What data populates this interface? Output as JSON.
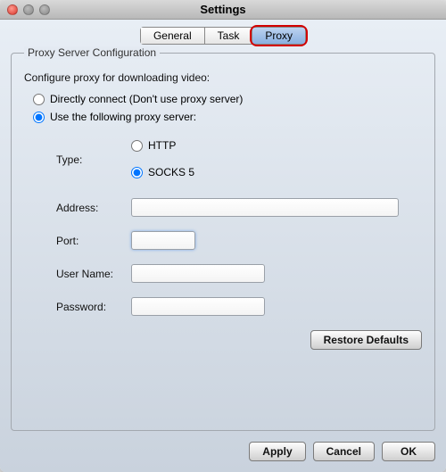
{
  "window": {
    "title": "Settings"
  },
  "tabs": {
    "general": "General",
    "task": "Task",
    "proxy": "Proxy"
  },
  "group": {
    "legend": "Proxy Server Configuration",
    "subtitle": "Configure proxy for downloading video:",
    "direct_label": "Directly connect (Don't use proxy server)",
    "useproxy_label": "Use the following proxy server:"
  },
  "form": {
    "type_label": "Type:",
    "http_label": "HTTP",
    "socks_label": "SOCKS 5",
    "address_label": "Address:",
    "address_value": "",
    "port_label": "Port:",
    "port_value": "",
    "user_label": "User Name:",
    "user_value": "",
    "pass_label": "Password:",
    "pass_value": ""
  },
  "buttons": {
    "restore": "Restore Defaults",
    "apply": "Apply",
    "cancel": "Cancel",
    "ok": "OK"
  }
}
